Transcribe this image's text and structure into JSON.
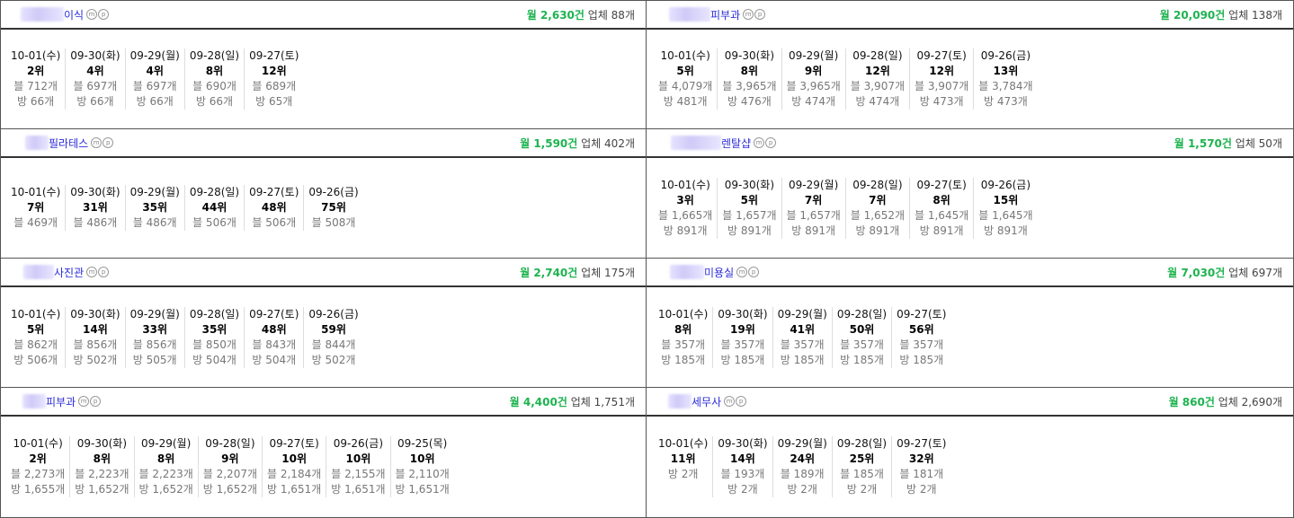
{
  "cards": [
    {
      "name": "이식",
      "blur_width": 48,
      "monthly": "월 2,630건",
      "biz": "업체 88개",
      "days": [
        {
          "date": "10-01(수)",
          "rank": "2위",
          "blog": "블 712개",
          "bang": "방 66개"
        },
        {
          "date": "09-30(화)",
          "rank": "4위",
          "blog": "블 697개",
          "bang": "방 66개"
        },
        {
          "date": "09-29(월)",
          "rank": "4위",
          "blog": "블 697개",
          "bang": "방 66개"
        },
        {
          "date": "09-28(일)",
          "rank": "8위",
          "blog": "블 690개",
          "bang": "방 66개"
        },
        {
          "date": "09-27(토)",
          "rank": "12위",
          "blog": "블 689개",
          "bang": "방 65개"
        }
      ]
    },
    {
      "name": "피부과",
      "blur_width": 46,
      "monthly": "월 20,090건",
      "biz": "업체 138개",
      "days": [
        {
          "date": "10-01(수)",
          "rank": "5위",
          "blog": "블 4,079개",
          "bang": "방 481개"
        },
        {
          "date": "09-30(화)",
          "rank": "8위",
          "blog": "블 3,965개",
          "bang": "방 476개"
        },
        {
          "date": "09-29(월)",
          "rank": "9위",
          "blog": "블 3,965개",
          "bang": "방 474개"
        },
        {
          "date": "09-28(일)",
          "rank": "12위",
          "blog": "블 3,907개",
          "bang": "방 474개"
        },
        {
          "date": "09-27(토)",
          "rank": "12위",
          "blog": "블 3,907개",
          "bang": "방 473개"
        },
        {
          "date": "09-26(금)",
          "rank": "13위",
          "blog": "블 3,784개",
          "bang": "방 473개"
        }
      ]
    },
    {
      "name": "필라테스",
      "blur_width": 26,
      "monthly": "월 1,590건",
      "biz": "업체 402개",
      "days": [
        {
          "date": "10-01(수)",
          "rank": "7위",
          "blog": "블 469개",
          "bang": ""
        },
        {
          "date": "09-30(화)",
          "rank": "31위",
          "blog": "블 486개",
          "bang": ""
        },
        {
          "date": "09-29(월)",
          "rank": "35위",
          "blog": "블 486개",
          "bang": ""
        },
        {
          "date": "09-28(일)",
          "rank": "44위",
          "blog": "블 506개",
          "bang": ""
        },
        {
          "date": "09-27(토)",
          "rank": "48위",
          "blog": "블 506개",
          "bang": ""
        },
        {
          "date": "09-26(금)",
          "rank": "75위",
          "blog": "블 508개",
          "bang": ""
        }
      ]
    },
    {
      "name": "렌탈샵",
      "blur_width": 56,
      "monthly": "월 1,570건",
      "biz": "업체 50개",
      "days": [
        {
          "date": "10-01(수)",
          "rank": "3위",
          "blog": "블 1,665개",
          "bang": "방 891개"
        },
        {
          "date": "09-30(화)",
          "rank": "5위",
          "blog": "블 1,657개",
          "bang": "방 891개"
        },
        {
          "date": "09-29(월)",
          "rank": "7위",
          "blog": "블 1,657개",
          "bang": "방 891개"
        },
        {
          "date": "09-28(일)",
          "rank": "7위",
          "blog": "블 1,652개",
          "bang": "방 891개"
        },
        {
          "date": "09-27(토)",
          "rank": "8위",
          "blog": "블 1,645개",
          "bang": "방 891개"
        },
        {
          "date": "09-26(금)",
          "rank": "15위",
          "blog": "블 1,645개",
          "bang": "방 891개"
        }
      ]
    },
    {
      "name": "사진관",
      "blur_width": 34,
      "monthly": "월 2,740건",
      "biz": "업체 175개",
      "days": [
        {
          "date": "10-01(수)",
          "rank": "5위",
          "blog": "블 862개",
          "bang": "방 506개"
        },
        {
          "date": "09-30(화)",
          "rank": "14위",
          "blog": "블 856개",
          "bang": "방 502개"
        },
        {
          "date": "09-29(월)",
          "rank": "33위",
          "blog": "블 856개",
          "bang": "방 505개"
        },
        {
          "date": "09-28(일)",
          "rank": "35위",
          "blog": "블 850개",
          "bang": "방 504개"
        },
        {
          "date": "09-27(토)",
          "rank": "48위",
          "blog": "블 843개",
          "bang": "방 504개"
        },
        {
          "date": "09-26(금)",
          "rank": "59위",
          "blog": "블 844개",
          "bang": "방 502개"
        }
      ]
    },
    {
      "name": "미용실",
      "blur_width": 38,
      "monthly": "월 7,030건",
      "biz": "업체 697개",
      "days": [
        {
          "date": "10-01(수)",
          "rank": "8위",
          "blog": "블 357개",
          "bang": "방 185개"
        },
        {
          "date": "09-30(화)",
          "rank": "19위",
          "blog": "블 357개",
          "bang": "방 185개"
        },
        {
          "date": "09-29(월)",
          "rank": "41위",
          "blog": "블 357개",
          "bang": "방 185개"
        },
        {
          "date": "09-28(일)",
          "rank": "50위",
          "blog": "블 357개",
          "bang": "방 185개"
        },
        {
          "date": "09-27(토)",
          "rank": "56위",
          "blog": "블 357개",
          "bang": "방 185개"
        }
      ]
    },
    {
      "name": "피부과",
      "blur_width": 26,
      "monthly": "월 4,400건",
      "biz": "업체 1,751개",
      "days": [
        {
          "date": "10-01(수)",
          "rank": "2위",
          "blog": "블 2,273개",
          "bang": "방 1,655개"
        },
        {
          "date": "09-30(화)",
          "rank": "8위",
          "blog": "블 2,223개",
          "bang": "방 1,652개"
        },
        {
          "date": "09-29(월)",
          "rank": "8위",
          "blog": "블 2,223개",
          "bang": "방 1,652개"
        },
        {
          "date": "09-28(일)",
          "rank": "9위",
          "blog": "블 2,207개",
          "bang": "방 1,652개"
        },
        {
          "date": "09-27(토)",
          "rank": "10위",
          "blog": "블 2,184개",
          "bang": "방 1,651개"
        },
        {
          "date": "09-26(금)",
          "rank": "10위",
          "blog": "블 2,155개",
          "bang": "방 1,651개"
        },
        {
          "date": "09-25(목)",
          "rank": "10위",
          "blog": "블 2,110개",
          "bang": "방 1,651개"
        }
      ]
    },
    {
      "name": "세무사",
      "blur_width": 26,
      "monthly": "월 860건",
      "biz": "업체 2,690개",
      "days": [
        {
          "date": "10-01(수)",
          "rank": "11위",
          "blog": "",
          "bang": "방 2개"
        },
        {
          "date": "09-30(화)",
          "rank": "14위",
          "blog": "블 193개",
          "bang": "방 2개"
        },
        {
          "date": "09-29(월)",
          "rank": "24위",
          "blog": "블 189개",
          "bang": "방 2개"
        },
        {
          "date": "09-28(일)",
          "rank": "25위",
          "blog": "블 185개",
          "bang": "방 2개"
        },
        {
          "date": "09-27(토)",
          "rank": "32위",
          "blog": "블 181개",
          "bang": "방 2개"
        }
      ]
    }
  ]
}
